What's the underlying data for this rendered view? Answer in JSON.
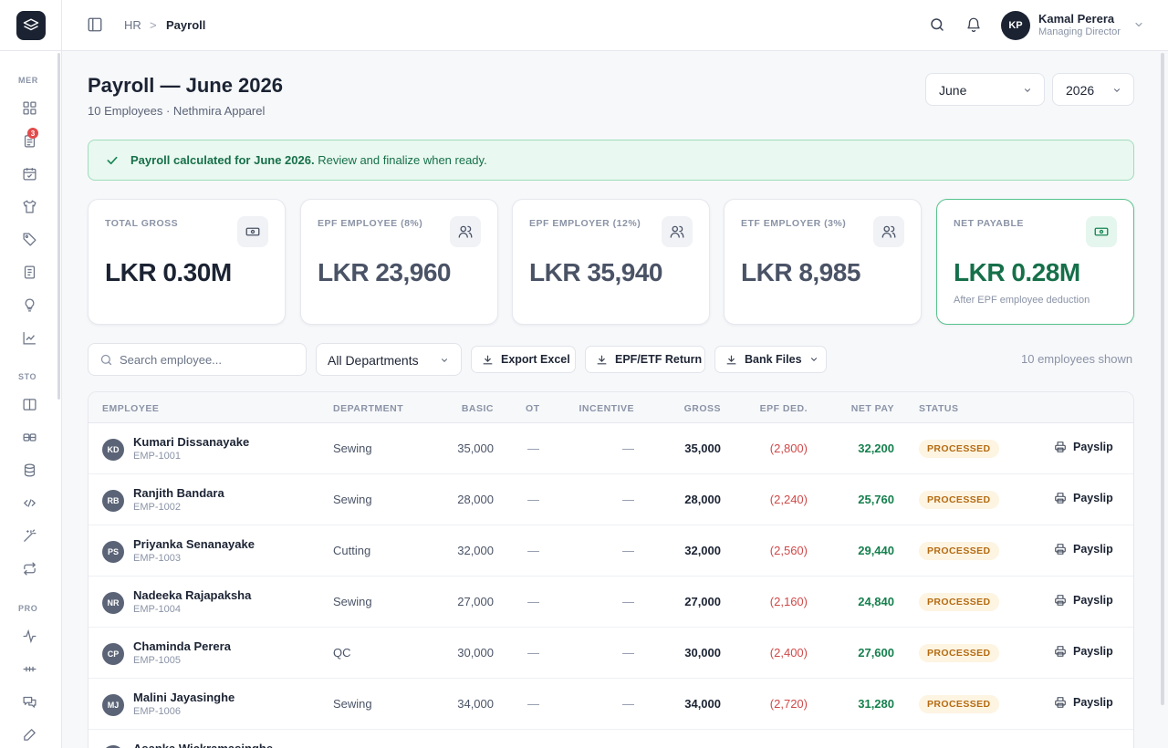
{
  "sidebar": {
    "sections": [
      "MER",
      "STO",
      "PRO"
    ],
    "badge_count": "3"
  },
  "header": {
    "breadcrumb_parent": "HR",
    "breadcrumb_separator": ">",
    "breadcrumb_current": "Payroll",
    "user": {
      "initials": "KP",
      "name": "Kamal Perera",
      "role": "Managing Director"
    }
  },
  "page": {
    "title": "Payroll — June 2026",
    "subtitle": "10 Employees · Nethmira Apparel",
    "month_select": "June",
    "year_select": "2026"
  },
  "alert": {
    "bold": "Payroll calculated for June 2026.",
    "text": " Review and finalize when ready."
  },
  "stats": [
    {
      "label": "TOTAL GROSS",
      "value": "LKR 0.30M",
      "icon": "cash-icon"
    },
    {
      "label": "EPF EMPLOYEE (8%)",
      "value": "LKR 23,960",
      "icon": "users-icon"
    },
    {
      "label": "EPF EMPLOYER (12%)",
      "value": "LKR 35,940",
      "icon": "users-icon"
    },
    {
      "label": "ETF EMPLOYER (3%)",
      "value": "LKR 8,985",
      "icon": "users-icon"
    },
    {
      "label": "NET PAYABLE",
      "value": "LKR 0.28M",
      "note": "After EPF employee deduction",
      "icon": "cash-icon"
    }
  ],
  "toolbar": {
    "search_placeholder": "Search employee...",
    "department_select": "All Departments",
    "export_excel": "Export Excel",
    "epf_etf_return": "EPF/ETF Return",
    "bank_files": "Bank Files",
    "shown_text": "10 employees shown"
  },
  "table": {
    "headers": [
      "EMPLOYEE",
      "DEPARTMENT",
      "BASIC",
      "OT",
      "INCENTIVE",
      "GROSS",
      "EPF DED.",
      "NET PAY",
      "STATUS"
    ],
    "payslip_label": "Payslip",
    "rows": [
      {
        "initials": "KD",
        "name": "Kumari Dissanayake",
        "id": "EMP-1001",
        "department": "Sewing",
        "basic": "35,000",
        "ot": "—",
        "incentive": "—",
        "gross": "35,000",
        "epf": "(2,800)",
        "net": "32,200",
        "status": "PROCESSED"
      },
      {
        "initials": "RB",
        "name": "Ranjith Bandara",
        "id": "EMP-1002",
        "department": "Sewing",
        "basic": "28,000",
        "ot": "—",
        "incentive": "—",
        "gross": "28,000",
        "epf": "(2,240)",
        "net": "25,760",
        "status": "PROCESSED"
      },
      {
        "initials": "PS",
        "name": "Priyanka Senanayake",
        "id": "EMP-1003",
        "department": "Cutting",
        "basic": "32,000",
        "ot": "—",
        "incentive": "—",
        "gross": "32,000",
        "epf": "(2,560)",
        "net": "29,440",
        "status": "PROCESSED"
      },
      {
        "initials": "NR",
        "name": "Nadeeka Rajapaksha",
        "id": "EMP-1004",
        "department": "Sewing",
        "basic": "27,000",
        "ot": "—",
        "incentive": "—",
        "gross": "27,000",
        "epf": "(2,160)",
        "net": "24,840",
        "status": "PROCESSED"
      },
      {
        "initials": "CP",
        "name": "Chaminda Perera",
        "id": "EMP-1005",
        "department": "QC",
        "basic": "30,000",
        "ot": "—",
        "incentive": "—",
        "gross": "30,000",
        "epf": "(2,400)",
        "net": "27,600",
        "status": "PROCESSED"
      },
      {
        "initials": "MJ",
        "name": "Malini Jayasinghe",
        "id": "EMP-1006",
        "department": "Sewing",
        "basic": "34,000",
        "ot": "—",
        "incentive": "—",
        "gross": "34,000",
        "epf": "(2,720)",
        "net": "31,280",
        "status": "PROCESSED"
      },
      {
        "initials": "AW",
        "name": "Asanka Wickramasinghe",
        "id": "",
        "department": "",
        "basic": "",
        "ot": "",
        "incentive": "",
        "gross": "",
        "epf": "",
        "net": "",
        "status": ""
      }
    ]
  }
}
